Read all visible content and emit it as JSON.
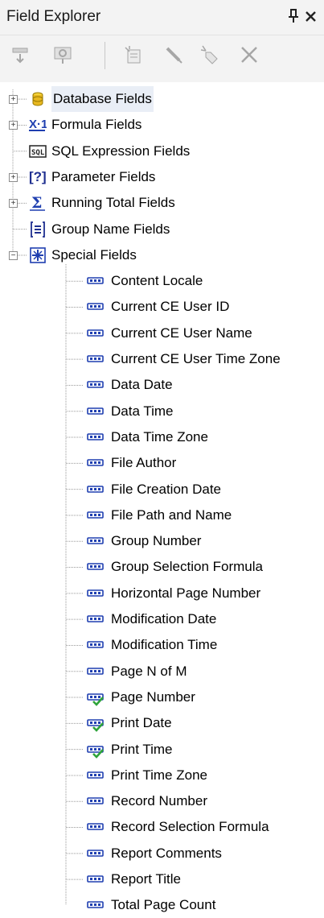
{
  "window": {
    "title": "Field Explorer",
    "pin_glyph": "ᵖ",
    "close_glyph": "✕"
  },
  "toolbar": {
    "buttons": [
      {
        "name": "insert-to-report",
        "icon": "insert-icon",
        "enabled": false
      },
      {
        "name": "browse-data",
        "icon": "browse-icon",
        "enabled": false
      },
      {
        "name": "new",
        "icon": "new-icon",
        "enabled": false
      },
      {
        "name": "edit",
        "icon": "edit-icon",
        "enabled": false
      },
      {
        "name": "rename",
        "icon": "rename-icon",
        "enabled": false
      },
      {
        "name": "delete",
        "icon": "delete-icon",
        "enabled": false
      }
    ]
  },
  "tree": {
    "top_level": [
      {
        "label": "Database Fields",
        "icon": "database-icon",
        "expander": "+",
        "selected": true
      },
      {
        "label": "Formula Fields",
        "icon": "formula-icon",
        "expander": "+"
      },
      {
        "label": "SQL Expression Fields",
        "icon": "sql-icon",
        "expander": ""
      },
      {
        "label": "Parameter Fields",
        "icon": "parameter-icon",
        "expander": "+"
      },
      {
        "label": "Running Total Fields",
        "icon": "running-total-icon",
        "expander": "+"
      },
      {
        "label": "Group Name Fields",
        "icon": "group-name-icon",
        "expander": ""
      },
      {
        "label": "Special Fields",
        "icon": "special-fields-icon",
        "expander": "−"
      }
    ],
    "special_fields": [
      {
        "label": "Content Locale",
        "used": false
      },
      {
        "label": "Current CE User ID",
        "used": false
      },
      {
        "label": "Current CE User Name",
        "used": false
      },
      {
        "label": "Current CE User Time Zone",
        "used": false
      },
      {
        "label": "Data Date",
        "used": false
      },
      {
        "label": "Data Time",
        "used": false
      },
      {
        "label": "Data Time Zone",
        "used": false
      },
      {
        "label": "File Author",
        "used": false
      },
      {
        "label": "File Creation Date",
        "used": false
      },
      {
        "label": "File Path and Name",
        "used": false
      },
      {
        "label": "Group Number",
        "used": false
      },
      {
        "label": "Group Selection Formula",
        "used": false
      },
      {
        "label": "Horizontal Page Number",
        "used": false
      },
      {
        "label": "Modification Date",
        "used": false
      },
      {
        "label": "Modification Time",
        "used": false
      },
      {
        "label": "Page N of M",
        "used": false
      },
      {
        "label": "Page Number",
        "used": true
      },
      {
        "label": "Print Date",
        "used": true
      },
      {
        "label": "Print Time",
        "used": true
      },
      {
        "label": "Print Time Zone",
        "used": false
      },
      {
        "label": "Record Number",
        "used": false
      },
      {
        "label": "Record Selection Formula",
        "used": false
      },
      {
        "label": "Report Comments",
        "used": false
      },
      {
        "label": "Report Title",
        "used": false
      },
      {
        "label": "Total Page Count",
        "used": false
      }
    ]
  },
  "colors": {
    "field_icon": "#1f3fb0",
    "check": "#2ea33a",
    "tree_line": "#9a9a9a",
    "toolbar_disabled": "#a6a6a6"
  }
}
